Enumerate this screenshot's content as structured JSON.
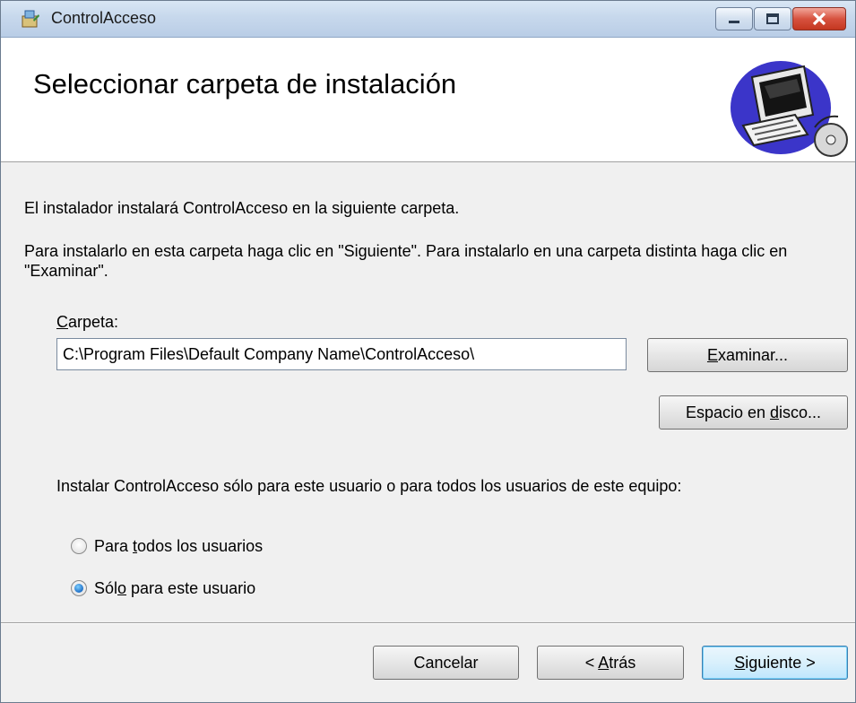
{
  "window": {
    "title": "ControlAcceso",
    "controls": {
      "minimize": "minimize",
      "maximize": "maximize",
      "close": "close"
    }
  },
  "header": {
    "title": "Seleccionar carpeta de instalación",
    "graphic_icon": "computer-setup-icon"
  },
  "body": {
    "intro": "El instalador instalará ControlAcceso en la siguiente carpeta.",
    "instructions": "Para instalarlo en esta carpeta haga clic en \"Siguiente\". Para instalarlo en una carpeta distinta haga clic en \"Examinar\".",
    "folder_label_mnemonic": "C",
    "folder_label_rest": "arpeta:",
    "folder_value": "C:\\Program Files\\Default Company Name\\ControlAcceso\\",
    "browse_pre": "",
    "browse_mnemonic": "E",
    "browse_post": "xaminar...",
    "disk_pre": "Espacio en ",
    "disk_mnemonic": "d",
    "disk_post": "isco...",
    "scope_question": "Instalar ControlAcceso sólo para este usuario o para todos los usuarios de este equipo:",
    "radio_all_pre": "Para ",
    "radio_all_mnemonic": "t",
    "radio_all_post": "odos los usuarios",
    "radio_me_pre": "Sól",
    "radio_me_mnemonic": "o",
    "radio_me_post": " para este usuario",
    "selected": "me"
  },
  "footer": {
    "cancel": "Cancelar",
    "back_pre": "< ",
    "back_mnemonic": "A",
    "back_post": "trás",
    "next_mnemonic": "S",
    "next_post": "iguiente >"
  }
}
